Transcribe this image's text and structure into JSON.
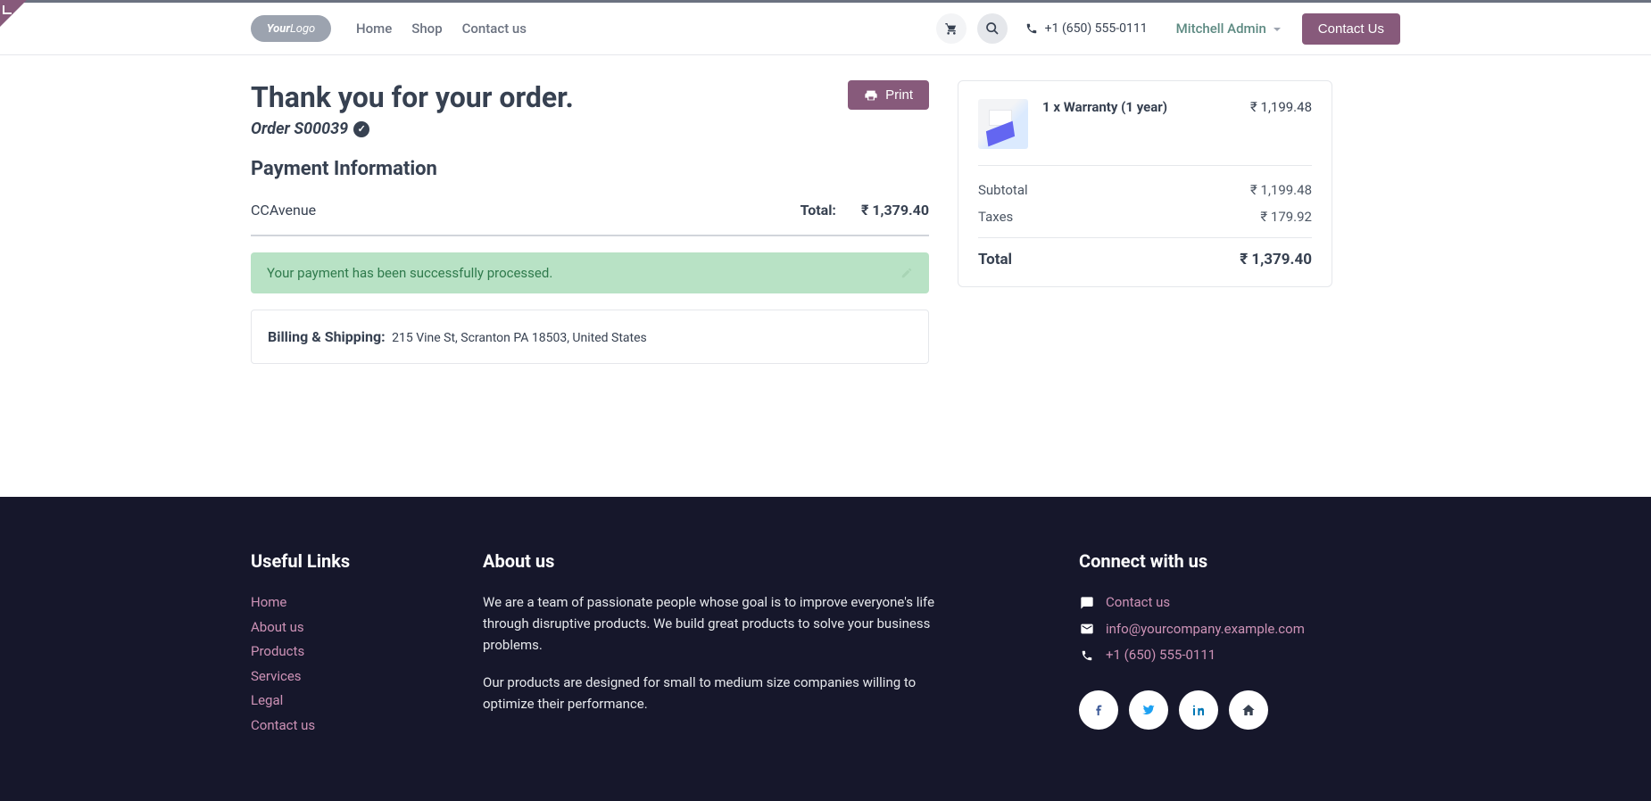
{
  "nav": {
    "links": [
      "Home",
      "Shop",
      "Contact us"
    ],
    "phone": "+1 (650) 555-0111",
    "user": "Mitchell Admin",
    "cta": "Contact Us"
  },
  "order": {
    "title": "Thank you for your order.",
    "number_label": "Order S00039",
    "print": "Print"
  },
  "payment": {
    "heading": "Payment Information",
    "method": "CCAvenue",
    "total_label": "Total:",
    "total_value": "₹ 1,379.40",
    "success": "Your payment has been successfully processed."
  },
  "shipping": {
    "label": "Billing & Shipping:",
    "address": "215 Vine St, Scranton PA 18503, United States"
  },
  "summary": {
    "item_name": "1 x Warranty (1 year)",
    "item_price": "₹ 1,199.48",
    "subtotal_label": "Subtotal",
    "subtotal_value": "₹ 1,199.48",
    "taxes_label": "Taxes",
    "taxes_value": "₹ 179.92",
    "total_label": "Total",
    "total_value": "₹ 1,379.40"
  },
  "footer": {
    "links_heading": "Useful Links",
    "links": [
      "Home",
      "About us",
      "Products",
      "Services",
      "Legal",
      "Contact us"
    ],
    "about_heading": "About us",
    "about_p1": "We are a team of passionate people whose goal is to improve everyone's life through disruptive products. We build great products to solve your business problems.",
    "about_p2": "Our products are designed for small to medium size companies willing to optimize their performance.",
    "connect_heading": "Connect with us",
    "contact_link": "Contact us",
    "email": "info@yourcompany.example.com",
    "phone": "+1 (650) 555-0111"
  }
}
